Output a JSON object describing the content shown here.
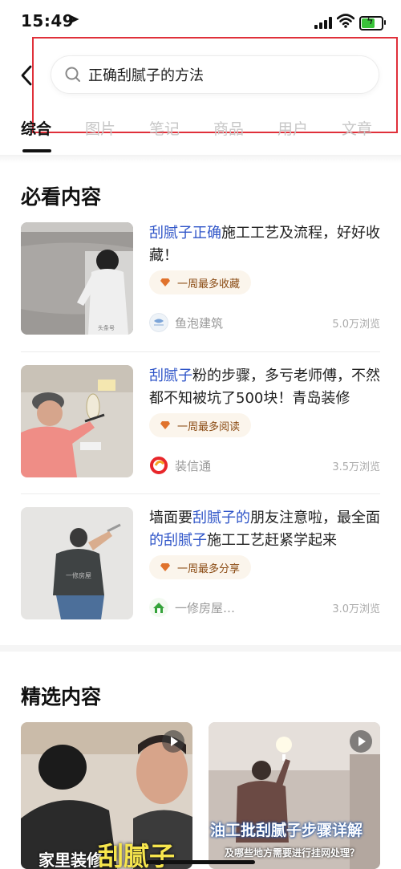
{
  "status": {
    "time": "15:49"
  },
  "search": {
    "query": "正确刮腻子的方法"
  },
  "tabs": [
    {
      "label": "综合"
    },
    {
      "label": "图片"
    },
    {
      "label": "笔记"
    },
    {
      "label": "商品"
    },
    {
      "label": "用户"
    },
    {
      "label": "文章"
    }
  ],
  "must_see": {
    "title": "必看内容",
    "items": [
      {
        "title_hl1": "刮腻子正确",
        "title_rest": "施工工艺及流程，好好收藏！",
        "badge": "一周最多收藏",
        "author": "鱼泡建筑",
        "views": "5.0万浏览"
      },
      {
        "title_hl1": "刮腻子",
        "title_rest": "粉的步骤，多亏老师傅，不然都不知被坑了500块！青岛装修",
        "badge": "一周最多阅读",
        "author": "装信通",
        "views": "3.5万浏览"
      },
      {
        "title_pre": "墙面要",
        "title_hl1": "刮腻子的",
        "title_mid": "朋友注意啦，最全面",
        "title_hl2": "的刮腻子",
        "title_rest": "施工工艺赶紧学起来",
        "badge": "一周最多分享",
        "author": "一修房屋…",
        "views": "3.0万浏览"
      }
    ]
  },
  "featured": {
    "title": "精选内容",
    "items": [
      {
        "caption1": "家里装修",
        "caption2": "刮腻子"
      },
      {
        "caption1": "油工批刮腻子步骤详解",
        "caption2": "及哪些地方需要进行挂网处理？"
      }
    ]
  },
  "colors": {
    "highlight": "#2f55c8",
    "badge_bg": "#fbf5ec",
    "badge_text": "#8a4a12",
    "annotation": "#e0303a"
  }
}
